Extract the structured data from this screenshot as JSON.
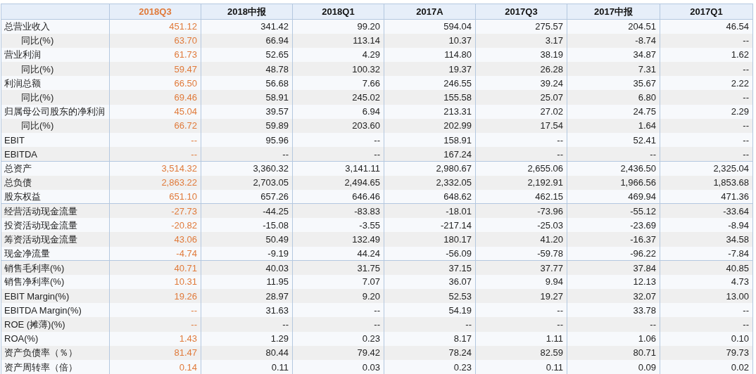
{
  "table": {
    "columns": [
      {
        "label": "2018Q3",
        "selected": true
      },
      {
        "label": "2018中报",
        "selected": false
      },
      {
        "label": "2018Q1",
        "selected": false
      },
      {
        "label": "2017A",
        "selected": false
      },
      {
        "label": "2017Q3",
        "selected": false
      },
      {
        "label": "2017中报",
        "selected": false
      },
      {
        "label": "2017Q1",
        "selected": false
      }
    ],
    "groups": [
      {
        "rows": [
          {
            "label": "总营业收入",
            "values": [
              "451.12",
              "341.42",
              "99.20",
              "594.04",
              "275.57",
              "204.51",
              "46.54"
            ],
            "children": [
              {
                "label": "同比(%)",
                "values": [
                  "63.70",
                  "66.94",
                  "113.14",
                  "10.37",
                  "3.17",
                  "-8.74",
                  "--"
                ]
              }
            ]
          },
          {
            "label": "营业利润",
            "values": [
              "61.73",
              "52.65",
              "4.29",
              "114.80",
              "38.19",
              "34.87",
              "1.62"
            ],
            "children": [
              {
                "label": "同比(%)",
                "values": [
                  "59.47",
                  "48.78",
                  "100.32",
                  "19.37",
                  "26.28",
                  "7.31",
                  "--"
                ]
              }
            ]
          },
          {
            "label": "利润总额",
            "values": [
              "66.50",
              "56.68",
              "7.66",
              "246.55",
              "39.24",
              "35.67",
              "2.22"
            ],
            "children": [
              {
                "label": "同比(%)",
                "values": [
                  "69.46",
                  "58.91",
                  "245.02",
                  "155.58",
                  "25.07",
                  "6.80",
                  "--"
                ]
              }
            ]
          },
          {
            "label": "归属母公司股东的净利润",
            "values": [
              "45.04",
              "39.57",
              "6.94",
              "213.31",
              "27.02",
              "24.75",
              "2.29"
            ],
            "children": [
              {
                "label": "同比(%)",
                "values": [
                  "66.72",
                  "59.89",
                  "203.60",
                  "202.99",
                  "17.54",
                  "1.64",
                  "--"
                ]
              }
            ]
          },
          {
            "label": "EBIT",
            "values": [
              "--",
              "95.96",
              "--",
              "158.91",
              "--",
              "52.41",
              "--"
            ]
          },
          {
            "label": "EBITDA",
            "values": [
              "--",
              "--",
              "--",
              "167.24",
              "--",
              "--",
              "--"
            ]
          }
        ]
      },
      {
        "rows": [
          {
            "label": "总资产",
            "values": [
              "3,514.32",
              "3,360.32",
              "3,141.11",
              "2,980.67",
              "2,655.06",
              "2,436.50",
              "2,325.04"
            ]
          },
          {
            "label": "总负债",
            "values": [
              "2,863.22",
              "2,703.05",
              "2,494.65",
              "2,332.05",
              "2,192.91",
              "1,966.56",
              "1,853.68"
            ]
          },
          {
            "label": "股东权益",
            "values": [
              "651.10",
              "657.26",
              "646.46",
              "648.62",
              "462.15",
              "469.94",
              "471.36"
            ]
          }
        ]
      },
      {
        "rows": [
          {
            "label": "经营活动现金流量",
            "values": [
              "-27.73",
              "-44.25",
              "-83.83",
              "-18.01",
              "-73.96",
              "-55.12",
              "-33.64"
            ]
          },
          {
            "label": "投资活动现金流量",
            "values": [
              "-20.82",
              "-15.08",
              "-3.55",
              "-217.14",
              "-25.03",
              "-23.69",
              "-8.94"
            ]
          },
          {
            "label": "筹资活动现金流量",
            "values": [
              "43.06",
              "50.49",
              "132.49",
              "180.17",
              "41.20",
              "-16.37",
              "34.58"
            ]
          },
          {
            "label": "现金净流量",
            "values": [
              "-4.74",
              "-9.19",
              "44.24",
              "-56.09",
              "-59.78",
              "-96.22",
              "-7.84"
            ]
          }
        ]
      },
      {
        "rows": [
          {
            "label": "销售毛利率(%)",
            "values": [
              "40.71",
              "40.03",
              "31.75",
              "37.15",
              "37.77",
              "37.84",
              "40.85"
            ]
          },
          {
            "label": "销售净利率(%)",
            "values": [
              "10.31",
              "11.95",
              "7.07",
              "36.07",
              "9.94",
              "12.13",
              "4.73"
            ]
          },
          {
            "label": "EBIT Margin(%)",
            "values": [
              "19.26",
              "28.97",
              "9.20",
              "52.53",
              "19.27",
              "32.07",
              "13.00"
            ]
          },
          {
            "label": "EBITDA Margin(%)",
            "values": [
              "--",
              "31.63",
              "--",
              "54.19",
              "--",
              "33.78",
              "--"
            ]
          },
          {
            "label": "ROE (摊薄)(%)",
            "values": [
              "--",
              "--",
              "--",
              "--",
              "--",
              "--",
              "--"
            ]
          },
          {
            "label": "ROA(%)",
            "values": [
              "1.43",
              "1.29",
              "0.23",
              "8.17",
              "1.11",
              "1.06",
              "0.10"
            ]
          },
          {
            "label": "资产负债率（％）",
            "values": [
              "81.47",
              "80.44",
              "79.42",
              "78.24",
              "82.59",
              "80.71",
              "79.73"
            ]
          },
          {
            "label": "资产周转率（倍）",
            "values": [
              "0.14",
              "0.11",
              "0.03",
              "0.23",
              "0.11",
              "0.09",
              "0.02"
            ]
          }
        ]
      }
    ]
  }
}
